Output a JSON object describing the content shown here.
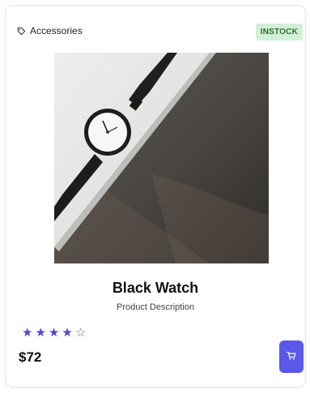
{
  "product": {
    "category": "Accessories",
    "stock_status": "INSTOCK",
    "title": "Black Watch",
    "description": "Product Description",
    "price": "$72",
    "rating": 4,
    "rating_max": 5
  },
  "icons": {
    "category": "tag-icon",
    "cart": "cart-icon",
    "star_filled": "star-icon",
    "star_empty": "star-outline-icon"
  },
  "colors": {
    "accent": "#5b57e8",
    "star": "#4b48d8",
    "badge_bg": "#d3f0d6",
    "badge_text": "#2f6b37"
  }
}
